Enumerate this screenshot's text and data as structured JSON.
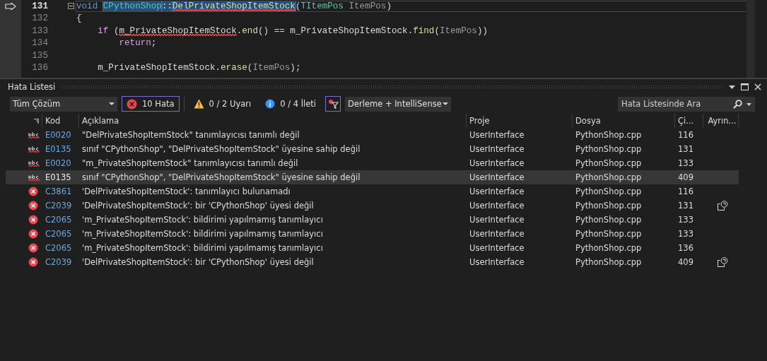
{
  "editor": {
    "lines": [
      {
        "number": "131",
        "current": true,
        "collapsible": true,
        "tokens": [
          {
            "kind": "keyword",
            "text": "void ",
            "selected": false,
            "squiggle": false
          },
          {
            "kind": "type",
            "text": "CPythonShop",
            "selected": true,
            "squiggle": false
          },
          {
            "kind": "plain",
            "text": "::",
            "selected": true,
            "squiggle": false
          },
          {
            "kind": "function",
            "text": "DelPrivateShopItemStock",
            "selected": true,
            "squiggle": true
          },
          {
            "kind": "plain",
            "text": "(",
            "selected": false,
            "squiggle": false
          },
          {
            "kind": "type",
            "text": "TItemPos",
            "selected": false,
            "squiggle": false
          },
          {
            "kind": "param",
            "text": " ItemPos",
            "selected": false,
            "squiggle": false
          },
          {
            "kind": "plain",
            "text": ")",
            "selected": false,
            "squiggle": false
          }
        ]
      },
      {
        "number": "132",
        "current": false,
        "collapsible": false,
        "tokens": [
          {
            "kind": "plain",
            "text": "{",
            "selected": false,
            "squiggle": false
          }
        ]
      },
      {
        "number": "133",
        "current": false,
        "collapsible": false,
        "tokens": [
          {
            "kind": "control",
            "text": "    if",
            "selected": false,
            "squiggle": false
          },
          {
            "kind": "plain",
            "text": " (",
            "selected": false,
            "squiggle": false
          },
          {
            "kind": "member",
            "text": "m_PrivateShopItemStock",
            "selected": false,
            "squiggle": true
          },
          {
            "kind": "plain",
            "text": ".",
            "selected": false,
            "squiggle": false
          },
          {
            "kind": "function",
            "text": "end",
            "selected": false,
            "squiggle": false
          },
          {
            "kind": "plain",
            "text": "() == ",
            "selected": false,
            "squiggle": false
          },
          {
            "kind": "member",
            "text": "m_PrivateShopItemStock",
            "selected": false,
            "squiggle": false
          },
          {
            "kind": "plain",
            "text": ".",
            "selected": false,
            "squiggle": false
          },
          {
            "kind": "function",
            "text": "find",
            "selected": false,
            "squiggle": false
          },
          {
            "kind": "plain",
            "text": "(",
            "selected": false,
            "squiggle": false
          },
          {
            "kind": "param",
            "text": "ItemPos",
            "selected": false,
            "squiggle": false
          },
          {
            "kind": "plain",
            "text": "))",
            "selected": false,
            "squiggle": false
          }
        ]
      },
      {
        "number": "134",
        "current": false,
        "collapsible": false,
        "tokens": [
          {
            "kind": "control",
            "text": "        return",
            "selected": false,
            "squiggle": false
          },
          {
            "kind": "plain",
            "text": ";",
            "selected": false,
            "squiggle": false
          }
        ]
      },
      {
        "number": "135",
        "current": false,
        "collapsible": false
      },
      {
        "number": "136",
        "current": false,
        "collapsible": false,
        "tokens": [
          {
            "kind": "member",
            "text": "    m_PrivateShopItemStock",
            "selected": false,
            "squiggle": false
          },
          {
            "kind": "plain",
            "text": ".",
            "selected": false,
            "squiggle": false
          },
          {
            "kind": "function",
            "text": "erase",
            "selected": false,
            "squiggle": false
          },
          {
            "kind": "plain",
            "text": "(",
            "selected": false,
            "squiggle": false
          },
          {
            "kind": "param",
            "text": "ItemPos",
            "selected": false,
            "squiggle": false
          },
          {
            "kind": "plain",
            "text": ");",
            "selected": false,
            "squiggle": false
          }
        ]
      }
    ]
  },
  "error_list": {
    "title": "Hata Listesi",
    "scope_dropdown": "Tüm Çözüm",
    "filters": [
      {
        "kind": "error",
        "label": "10 Hata",
        "selected": true
      },
      {
        "kind": "warning",
        "label": "0 / 2 Uyarı",
        "selected": false
      },
      {
        "kind": "info",
        "label": "0 / 4 İleti",
        "selected": false
      }
    ],
    "filter_toggle": {
      "on": true
    },
    "source_dropdown": "Derleme + IntelliSense",
    "search": {
      "placeholder": "Hata Listesinde Ara"
    },
    "columns": [
      "Kod",
      "Açıklama",
      "Proje",
      "Dosya",
      "Çi...",
      "Ayrın..."
    ],
    "rows": [
      {
        "kind": "intellisense",
        "code": "E0020",
        "description": "\"DelPrivateShopItemStock\" tanımlayıcısı tanımlı değil",
        "project": "UserInterface",
        "file": "PythonShop.cpp",
        "line": "116",
        "details": false,
        "selected": false
      },
      {
        "kind": "intellisense",
        "code": "E0135",
        "description": "sınıf \"CPythonShop\", \"DelPrivateShopItemStock\" üyesine sahip değil",
        "project": "UserInterface",
        "file": "PythonShop.cpp",
        "line": "131",
        "details": false,
        "selected": false
      },
      {
        "kind": "intellisense",
        "code": "E0020",
        "description": "\"m_PrivateShopItemStock\" tanımlayıcısı tanımlı değil",
        "project": "UserInterface",
        "file": "PythonShop.cpp",
        "line": "133",
        "details": false,
        "selected": false
      },
      {
        "kind": "intellisense",
        "code": "E0135",
        "description": "sınıf \"CPythonShop\", \"DelPrivateShopItemStock\" üyesine sahip değil",
        "project": "UserInterface",
        "file": "PythonShop.cpp",
        "line": "409",
        "details": false,
        "selected": true
      },
      {
        "kind": "build",
        "code": "C3861",
        "description": "'DelPrivateShopItemStock': tanımlayıcı bulunamadı",
        "project": "UserInterface",
        "file": "PythonShop.cpp",
        "line": "116",
        "details": false,
        "selected": false
      },
      {
        "kind": "build",
        "code": "C2039",
        "description": "'DelPrivateShopItemStock': bir 'CPythonShop' üyesi değil",
        "project": "UserInterface",
        "file": "PythonShop.cpp",
        "line": "131",
        "details": true,
        "selected": false
      },
      {
        "kind": "build",
        "code": "C2065",
        "description": "'m_PrivateShopItemStock': bildirimi yapılmamış tanımlayıcı",
        "project": "UserInterface",
        "file": "PythonShop.cpp",
        "line": "133",
        "details": false,
        "selected": false
      },
      {
        "kind": "build",
        "code": "C2065",
        "description": "'m_PrivateShopItemStock': bildirimi yapılmamış tanımlayıcı",
        "project": "UserInterface",
        "file": "PythonShop.cpp",
        "line": "133",
        "details": false,
        "selected": false
      },
      {
        "kind": "build",
        "code": "C2065",
        "description": "'m_PrivateShopItemStock': bildirimi yapılmamış tanımlayıcı",
        "project": "UserInterface",
        "file": "PythonShop.cpp",
        "line": "136",
        "details": false,
        "selected": false
      },
      {
        "kind": "build",
        "code": "C2039",
        "description": "'DelPrivateShopItemStock': bir 'CPythonShop' üyesi değil",
        "project": "UserInterface",
        "file": "PythonShop.cpp",
        "line": "409",
        "details": true,
        "selected": false
      }
    ]
  }
}
